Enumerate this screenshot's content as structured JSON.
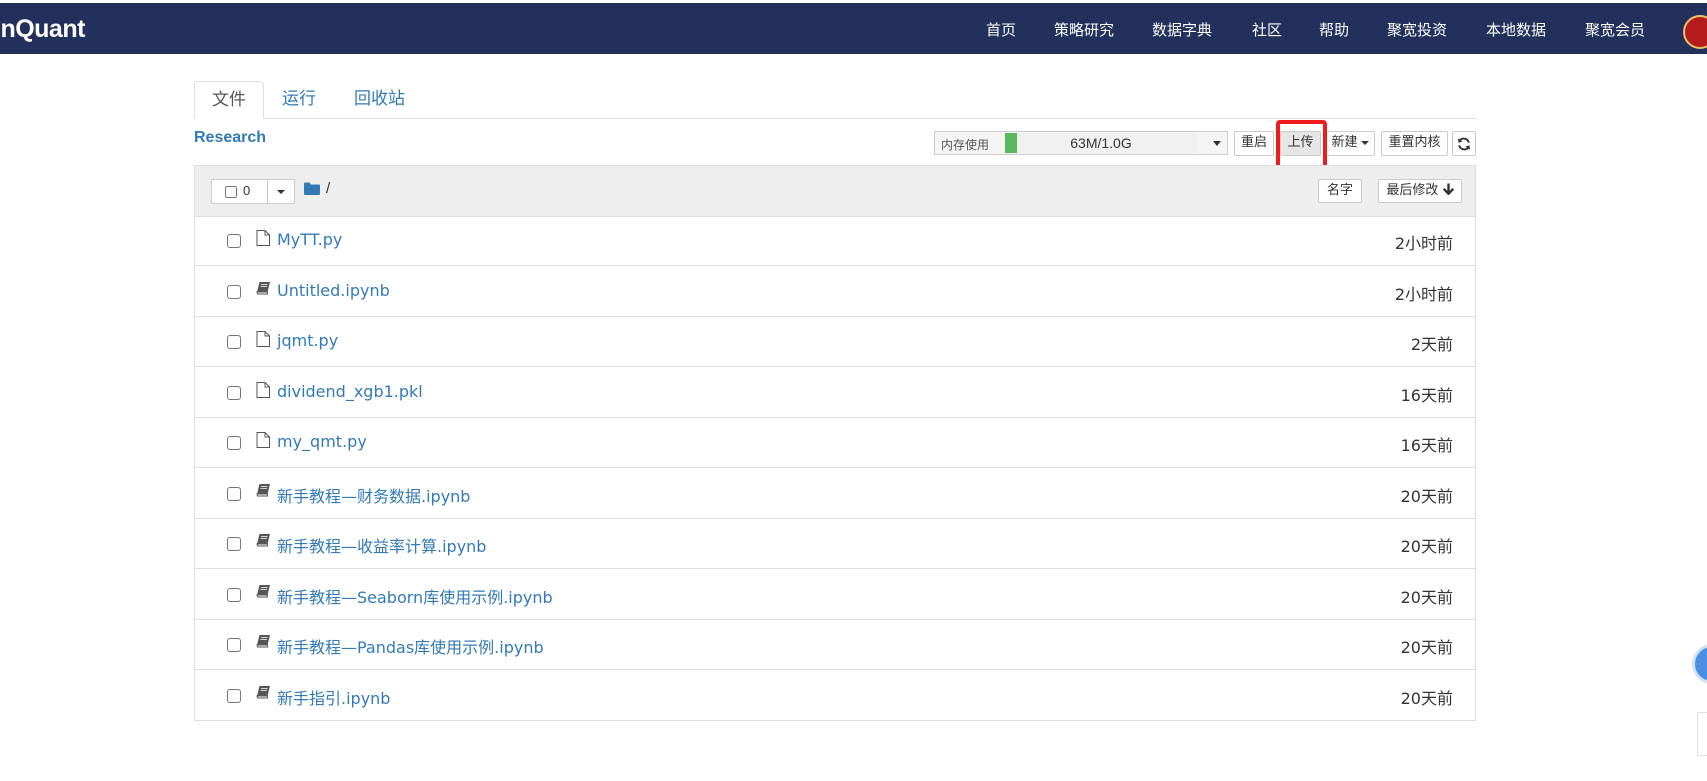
{
  "header": {
    "brand": "inQuant",
    "nav": [
      {
        "label": "首页"
      },
      {
        "label": "策略研究"
      },
      {
        "label": "数据字典"
      },
      {
        "label": "社区"
      },
      {
        "label": "帮助"
      },
      {
        "label": "聚宽投资"
      },
      {
        "label": "本地数据"
      },
      {
        "label": "聚宽会员"
      }
    ]
  },
  "tabs": [
    {
      "label": "文件",
      "active": true
    },
    {
      "label": "运行",
      "active": false
    },
    {
      "label": "回收站",
      "active": false
    }
  ],
  "toolbar": {
    "breadcrumb": "Research",
    "memory_label": "内存使用",
    "memory_value": "63M/1.0G",
    "memory_used_fraction": 0.06,
    "restart_label": "重启",
    "upload_label": "上传",
    "new_label": "新建",
    "reset_kernel_label": "重置内核"
  },
  "list_header": {
    "selected_count": "0",
    "path": "/",
    "sort_name_label": "名字",
    "sort_modified_label": "最后修改"
  },
  "files": [
    {
      "name": "MyTT.py",
      "type": "file",
      "modified": "2小时前"
    },
    {
      "name": "Untitled.ipynb",
      "type": "notebook",
      "modified": "2小时前"
    },
    {
      "name": "jqmt.py",
      "type": "file",
      "modified": "2天前"
    },
    {
      "name": "dividend_xgb1.pkl",
      "type": "file",
      "modified": "16天前"
    },
    {
      "name": "my_qmt.py",
      "type": "file",
      "modified": "16天前"
    },
    {
      "name": "新手教程—财务数据.ipynb",
      "type": "notebook",
      "modified": "20天前"
    },
    {
      "name": "新手教程—收益率计算.ipynb",
      "type": "notebook",
      "modified": "20天前"
    },
    {
      "name": "新手教程—Seaborn库使用示例.ipynb",
      "type": "notebook",
      "modified": "20天前"
    },
    {
      "name": "新手教程—Pandas库使用示例.ipynb",
      "type": "notebook",
      "modified": "20天前"
    },
    {
      "name": "新手指引.ipynb",
      "type": "notebook",
      "modified": "20天前"
    }
  ],
  "colors": {
    "navbar_bg": "#22305b",
    "link": "#337ab7",
    "memory_bar": "#5cb85c",
    "highlight": "#ee1c1c"
  }
}
